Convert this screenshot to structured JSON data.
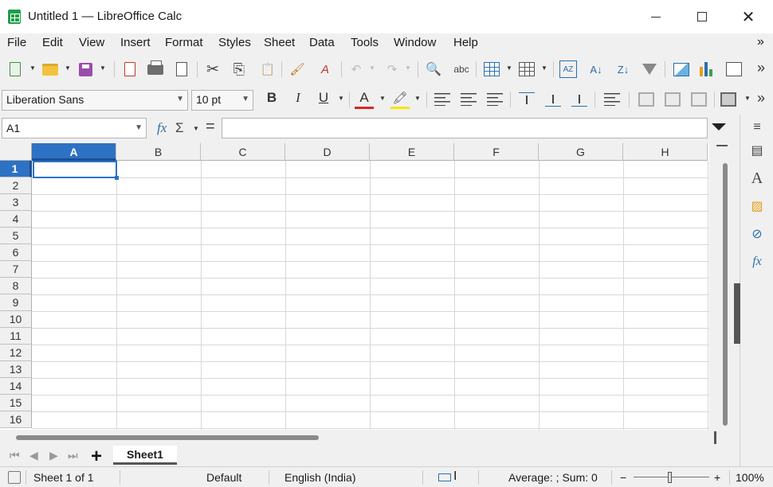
{
  "window": {
    "title": "Untitled 1 — LibreOffice Calc",
    "minimize_icon": "minimize-icon",
    "maximize_icon": "maximize-icon",
    "close_glyph": "✕"
  },
  "menu": {
    "items": [
      "File",
      "Edit",
      "View",
      "Insert",
      "Format",
      "Styles",
      "Sheet",
      "Data",
      "Tools",
      "Window",
      "Help"
    ],
    "more": "»"
  },
  "toolbar": {
    "more": "»",
    "undo": "↶",
    "redo": "↷",
    "sort_asc": "A↓",
    "sort_desc": "Z↓",
    "spellcheck": "abc",
    "find": "🔍",
    "cut": "✂",
    "copy": "⎘",
    "paste": "📋",
    "clone": "🖌",
    "clear": "A"
  },
  "formatting": {
    "font_name": "Liberation Sans",
    "font_size": "10 pt",
    "bold": "B",
    "italic": "I",
    "underline": "U",
    "font_color_glyph": "A",
    "font_color": "#d62828",
    "highlight_color": "#f5e400",
    "more": "»"
  },
  "formula_bar": {
    "name_box": "A1",
    "fx": "fx",
    "sigma": "Σ",
    "equals": "=",
    "content": ""
  },
  "grid": {
    "columns": [
      "A",
      "B",
      "C",
      "D",
      "E",
      "F",
      "G",
      "H"
    ],
    "rows": [
      "1",
      "2",
      "3",
      "4",
      "5",
      "6",
      "7",
      "8",
      "9",
      "10",
      "11",
      "12",
      "13",
      "14",
      "15",
      "16"
    ],
    "active_cell": "A1",
    "accent": "#2e72c4"
  },
  "sidebar": {
    "icons": [
      "menu-icon",
      "properties-icon",
      "styles-icon",
      "gallery-icon",
      "navigator-icon",
      "functions-icon"
    ],
    "glyphs": [
      "≡",
      "▤",
      "A",
      "▨",
      "⊘",
      "fx"
    ]
  },
  "sheets": {
    "tabs": [
      "Sheet1"
    ],
    "add": "+",
    "nav": [
      "⏮",
      "◀",
      "▶",
      "⏭"
    ]
  },
  "status": {
    "sheet_info": "Sheet 1 of 1",
    "page_style": "Default",
    "language": "English (India)",
    "summary": "Average: ; Sum: 0",
    "zoom_minus": "−",
    "zoom_plus": "+",
    "zoom": "100%"
  }
}
